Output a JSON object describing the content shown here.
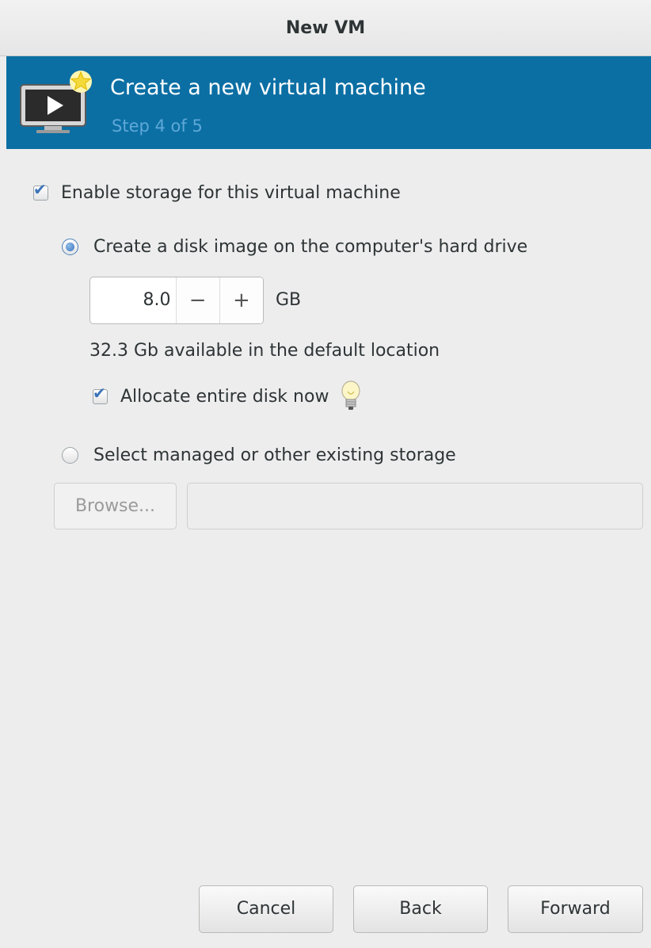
{
  "window": {
    "title": "New VM"
  },
  "banner": {
    "title": "Create a new virtual machine",
    "step": "Step 4 of 5",
    "icon": "vm-monitor-new-icon",
    "background": "#0b6fa4"
  },
  "storage": {
    "enable_label": "Enable storage for this virtual machine",
    "enable_checked": true,
    "create_disk_label": "Create a disk image on the computer's hard drive",
    "create_disk_selected": true,
    "size_value": "8.0",
    "decrement_label": "−",
    "increment_label": "+",
    "size_unit": "GB",
    "available_text": "32.3 Gb available in the default location",
    "allocate_label": "Allocate entire disk now",
    "allocate_checked": true,
    "existing_label": "Select managed or other existing storage",
    "existing_selected": false,
    "browse_label": "Browse...",
    "path_value": ""
  },
  "buttons": {
    "cancel": "Cancel",
    "back": "Back",
    "forward": "Forward"
  }
}
